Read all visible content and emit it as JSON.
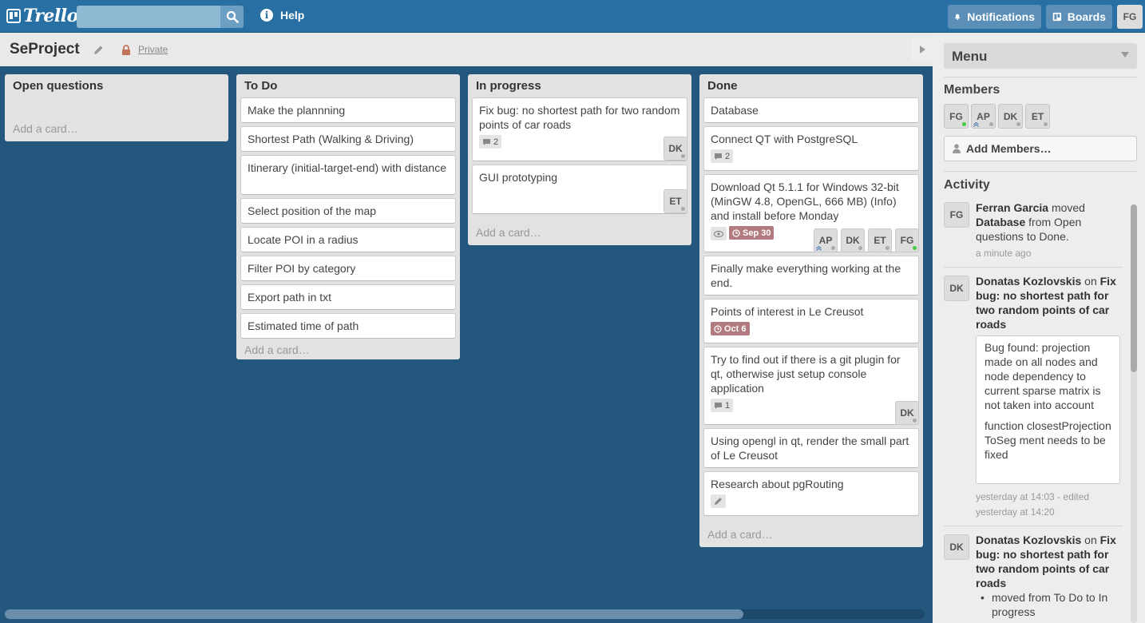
{
  "header": {
    "logo_text": "Trello",
    "search_placeholder": "",
    "help_label": "Help",
    "notifications_label": "Notifications",
    "boards_label": "Boards",
    "user_initials": "FG"
  },
  "board": {
    "title": "SeProject",
    "privacy": "Private"
  },
  "lists": [
    {
      "title": "Open questions",
      "add_card": "Add a card…"
    },
    {
      "title": "To Do",
      "add_card": "Add a card…",
      "cards": [
        "Make the plannning",
        "Shortest Path (Walking & Driving)",
        "Itinerary (initial-target-end) with distance",
        "Select position of the map",
        "Locate POI in a radius",
        "Filter POI by category",
        "Export path in txt",
        "Estimated time of path"
      ]
    },
    {
      "title": "In progress",
      "add_card": "Add a card…",
      "cards": [
        {
          "text": "Fix bug: no shortest path for two random points of car roads",
          "comments": "2",
          "member": "DK"
        },
        {
          "text": "GUI prototyping",
          "member": "ET"
        }
      ]
    },
    {
      "title": "Done",
      "add_card": "Add a card…",
      "cards": [
        {
          "text": "Database"
        },
        {
          "text": "Connect QT with PostgreSQL",
          "comments": "2"
        },
        {
          "text": "Download Qt 5.1.1 for Windows 32-bit (MinGW 4.8, OpenGL, 666 MB) (Info) and install before Monday",
          "due": "Sep 30",
          "members": [
            "AP",
            "DK",
            "ET",
            "FG"
          ]
        },
        {
          "text": "Finally make everything working at the end."
        },
        {
          "text": "Points of interest in Le Creusot",
          "due": "Oct 6"
        },
        {
          "text": "Try to find out if there is a git plugin for qt, otherwise just setup console application",
          "comments": "1",
          "member": "DK"
        },
        {
          "text": "Using opengl in qt, render the small part of Le Creusot"
        },
        {
          "text": "Research about pgRouting"
        }
      ]
    }
  ],
  "sidebar": {
    "menu_title": "Menu",
    "members_heading": "Members",
    "members": [
      "FG",
      "AP",
      "DK",
      "ET"
    ],
    "add_members": "Add Members…",
    "activity_heading": "Activity",
    "activity": [
      {
        "initials": "FG",
        "actor": "Ferran Garcia",
        "pre": " moved ",
        "target": "Database",
        "post": " from Open questions to Done.",
        "time": "a minute ago"
      },
      {
        "initials": "DK",
        "actor": "Donatas Kozlovskis",
        "pre": " on ",
        "target": "Fix bug: no shortest path for two random points of car roads",
        "comment_p1": "Bug found: projection made on all nodes and node dependency to current sparse matrix is not taken into account",
        "comment_p2": "function closestProjectionToSeg ment needs to be fixed",
        "time1": "yesterday at 14:03 - edited",
        "time2": "yesterday at 14:20"
      },
      {
        "initials": "DK",
        "actor": "Donatas Kozlovskis",
        "pre": " on ",
        "target": "Fix bug: no shortest path for two random points of car roads",
        "bullet": "moved from To Do to In progress"
      }
    ]
  },
  "colors": {
    "header": "#2870a4",
    "board_bg": "#23577d",
    "due_badge": "#b07a7f"
  }
}
